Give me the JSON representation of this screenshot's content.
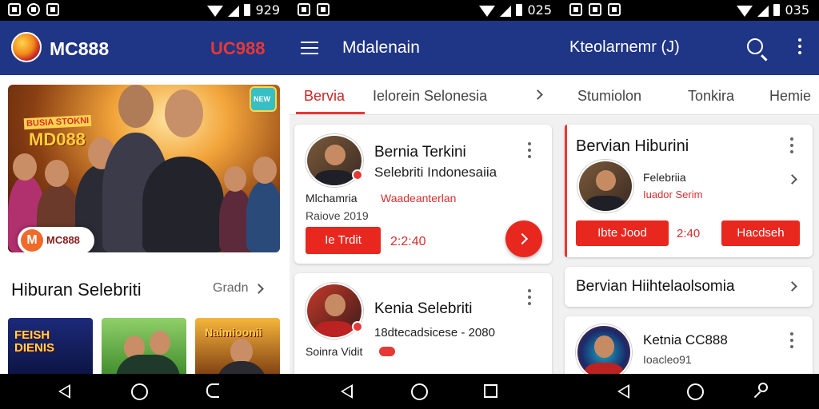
{
  "p1": {
    "status": {
      "time": "929"
    },
    "appbar": {
      "brand": "MC888",
      "brand2": "UC988"
    },
    "hero": {
      "label_top": "BUSIA STOKNI",
      "label_big": "MD088",
      "logo_mark": "M",
      "logo_text": "MC888"
    },
    "section": {
      "title": "Hiburan Selebriti",
      "more": "Gradn"
    },
    "thumbs": [
      {
        "text": "FEISH DIENIS",
        "color_top": "#1b2a7a",
        "color_bottom": "#0c1340"
      },
      {
        "text": "",
        "color_top": "#8fcf6a",
        "color_bottom": "#3e8a2a"
      },
      {
        "text": "Naimioonii",
        "color_top": "#f5b53b",
        "color_bottom": "#7a3a10"
      }
    ]
  },
  "p2": {
    "status": {
      "time": "025"
    },
    "appbar": {
      "title": "Mdalenain"
    },
    "tabs": [
      {
        "label": "Bervia",
        "active": true
      },
      {
        "label": "Ielorein Selonesia",
        "active": false
      }
    ],
    "card1": {
      "title": "Bernia Terkini",
      "subtitle": "Selebriti Indonesaiia",
      "name": "Mlchamria",
      "date": "Raiove 2019",
      "tag": "Waadeanterlan",
      "button": "Ie Trdit",
      "count": "2:2:40"
    },
    "card2": {
      "title": "Kenia Selebriti",
      "meta": "18dtecadsicese - 2080",
      "name": "Soinra Vidit"
    }
  },
  "p3": {
    "status": {
      "time": "035"
    },
    "appbar": {
      "title": "Kteolarnemr (J)"
    },
    "tabs": [
      {
        "label": "Stumiolon"
      },
      {
        "label": "Tonkira"
      },
      {
        "label": "Hemie"
      }
    ],
    "card1": {
      "title": "Bervian Hiburini",
      "line1": "Felebriia",
      "line2": "Iuador Serim",
      "button1": "Ibte Jood",
      "count": "2:40",
      "button2": "Hacdseh"
    },
    "row": {
      "title": "Bervian Hiihtelaolsomia"
    },
    "card2": {
      "title": "Ketnia CC888",
      "sub": "Ioacleo91"
    }
  }
}
